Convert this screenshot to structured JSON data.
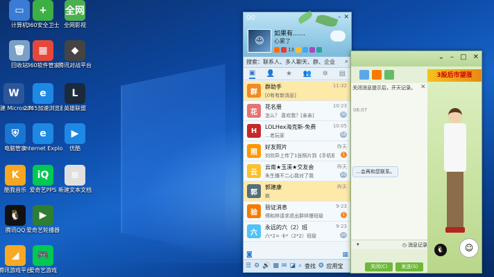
{
  "desktop": {
    "icons": [
      {
        "label": "计算机",
        "icon": "computer-icon",
        "color": "#3a7bd5",
        "glyph": "▭"
      },
      {
        "label": "360安全卫士",
        "icon": "360-safe-icon",
        "color": "#3cb043",
        "glyph": "+"
      },
      {
        "label": "全网影视",
        "icon": "video-icon",
        "color": "#4caf50",
        "glyph": "全网"
      },
      {
        "label": "回收站",
        "icon": "recycle-bin-icon",
        "color": "#7aa0c4",
        "glyph": "🗑"
      },
      {
        "label": "360软件管家",
        "icon": "360-software-icon",
        "color": "#e5483a",
        "glyph": "▦"
      },
      {
        "label": "腾讯对战平台",
        "icon": "tencent-battle-icon",
        "color": "#444444",
        "glyph": "◆"
      },
      {
        "label": "新建 Microsoft ...",
        "icon": "word-doc-icon",
        "color": "#2b579a",
        "glyph": "W"
      },
      {
        "label": "2345加速浏览器",
        "icon": "browser-2345-icon",
        "color": "#1e88e5",
        "glyph": "e"
      },
      {
        "label": "英雄联盟",
        "icon": "lol-icon",
        "color": "#1a2a3a",
        "glyph": "L"
      },
      {
        "label": "电脑管家",
        "icon": "pc-manager-icon",
        "color": "#1976d2",
        "glyph": "⛨"
      },
      {
        "label": "Internet Explorer",
        "icon": "ie-icon",
        "color": "#1e88e5",
        "glyph": "e"
      },
      {
        "label": "优酷",
        "icon": "youku-icon",
        "color": "#1e88e5",
        "glyph": "▶"
      },
      {
        "label": "酷我音乐",
        "icon": "kuwo-icon",
        "color": "#f5a623",
        "glyph": "K"
      },
      {
        "label": "爱奇艺PPS",
        "icon": "iqiyi-icon",
        "color": "#00c853",
        "glyph": "iQ"
      },
      {
        "label": "新建文本文档",
        "icon": "text-doc-icon",
        "color": "#e0e0e0",
        "glyph": "≡"
      },
      {
        "label": "腾讯QQ",
        "icon": "qq-icon",
        "color": "#111111",
        "glyph": "🐧"
      },
      {
        "label": "爱奇艺轮播器",
        "icon": "iqiyi-carousel-icon",
        "color": "#2e7d32",
        "glyph": "▶"
      },
      {
        "label": "腾讯游戏平台",
        "icon": "tencent-game-icon",
        "color": "#f9a825",
        "glyph": "◢"
      },
      {
        "label": "爱奇艺游戏",
        "icon": "iqiyi-game-icon",
        "color": "#00c853",
        "glyph": "🎮"
      }
    ]
  },
  "qq": {
    "logo": "QQ",
    "nickname": "如果有……",
    "mood": "心累了",
    "level_count": "13",
    "search_placeholder": "搜索：联系人、多人聊天、群、企业",
    "tabs": [
      "message",
      "contacts",
      "star",
      "groups",
      "settings",
      "more"
    ],
    "messages": [
      {
        "name": "群助手",
        "preview": "[0有有新消息]",
        "time": "11:32",
        "badge": "",
        "color": "#f08a24",
        "initial": "群",
        "highlight": true
      },
      {
        "name": "花名册",
        "preview": "怎么？    喜欢我？[亲亲]",
        "time": "10:23",
        "badge": "30",
        "color": "#e57373",
        "initial": "花",
        "highlight": false
      },
      {
        "name": "LOLHex海克斯-免费",
        "preview": "…老玩家",
        "time": "10:05",
        "badge": "58",
        "color": "#c62828",
        "initial": "H",
        "highlight": false
      },
      {
        "name": "好友照片",
        "preview": "刘欣异上传了1张照片到《手机相",
        "time": "昨天",
        "badge": "1",
        "color": "#ff9800",
        "initial": "照",
        "highlight": false
      },
      {
        "name": "云南★玉溪★交友会",
        "preview": "朱生播不二心我对了我",
        "time": "昨天",
        "badge": "20",
        "color": "#fbc02d",
        "initial": "云",
        "highlight": false
      },
      {
        "name": "郭建康",
        "preview": "疯",
        "time": "昨天",
        "badge": "",
        "color": "#546e7a",
        "initial": "郭",
        "highlight": true
      },
      {
        "name": "验证消息",
        "preview": "傅和林请求退出群祥爆班级",
        "time": "9-23",
        "badge": "1",
        "color": "#f57c00",
        "initial": "验",
        "highlight": false
      },
      {
        "name": "永远的六（2）班",
        "preview": "六*2= 卡*（2*2）班级",
        "time": "9-23",
        "badge": "20",
        "color": "#4fc3f7",
        "initial": "六",
        "highlight": false
      }
    ],
    "footer": {
      "search_label": "查找",
      "app_label": "应用宝"
    }
  },
  "chat": {
    "hint": "关闭消息提示后，开天记录。",
    "time1": "06:07",
    "bubble": "…会再和您联系。",
    "time2": "",
    "history_label": "消息记录",
    "close_label": "关闭(C)",
    "send_label": "发送(S)",
    "ad_banner": "3股后市望涨"
  }
}
